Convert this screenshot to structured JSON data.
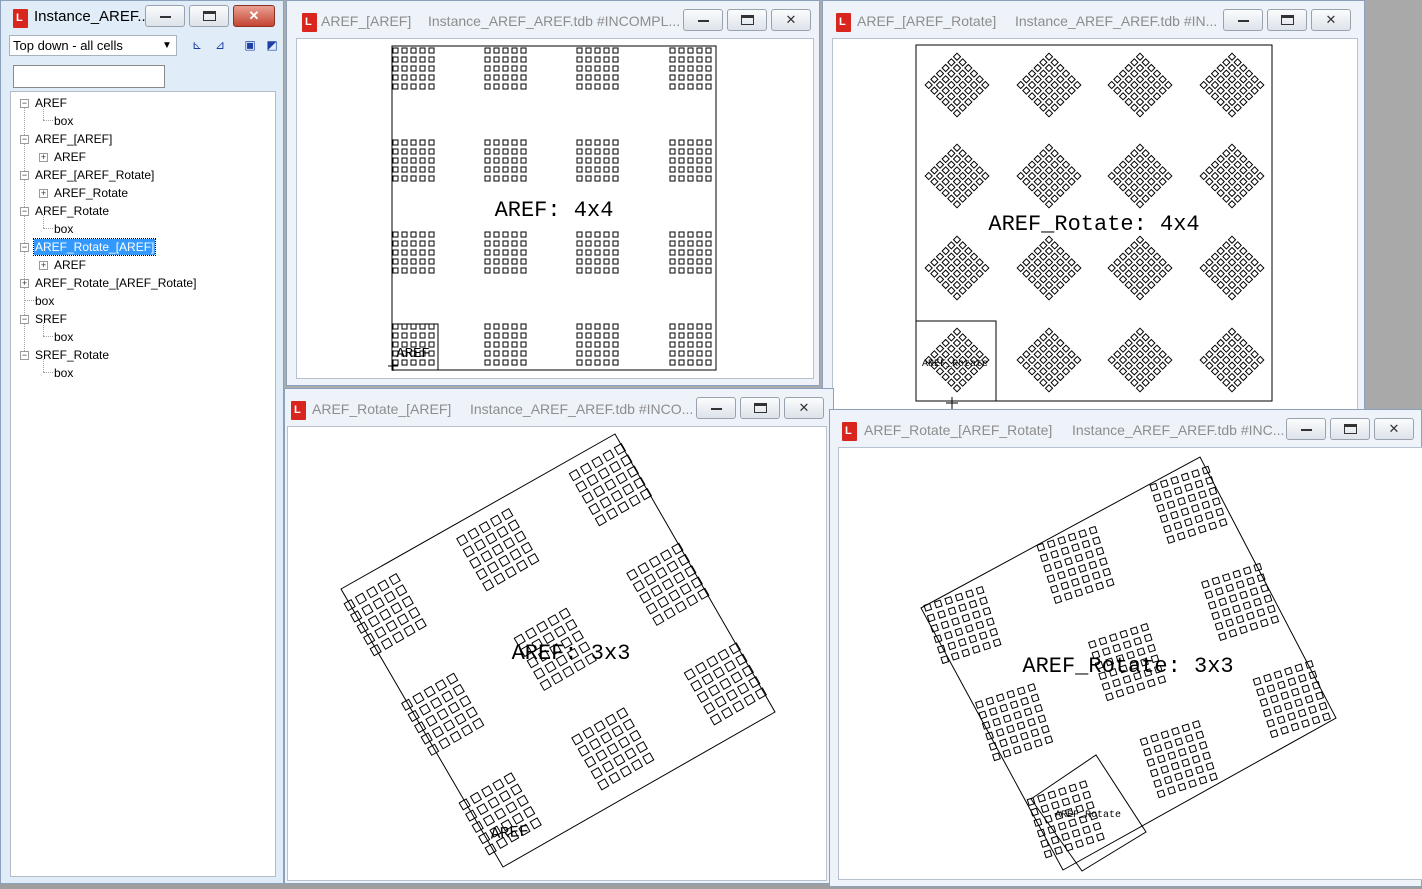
{
  "tree_window": {
    "title": "Instance_AREF...",
    "filter": "Top down - all cells",
    "search_value": "",
    "nodes": [
      "AREF",
      "box",
      "AREF_[AREF]",
      "AREF",
      "AREF_[AREF_Rotate]",
      "AREF_Rotate",
      "AREF_Rotate",
      "box",
      "AREF_Rotate_[AREF]",
      "AREF",
      "AREF_Rotate_[AREF_Rotate]",
      "box",
      "SREF",
      "box",
      "SREF_Rotate",
      "box"
    ]
  },
  "windows": [
    {
      "cell": "AREF_[AREF]",
      "file": "Instance_AREF_AREF.tdb #INCOMPL...",
      "label": "AREF: 4x4",
      "sub_label": "AREF"
    },
    {
      "cell": "AREF_[AREF_Rotate]",
      "file": "Instance_AREF_AREF.tdb #IN...",
      "label": "AREF_Rotate: 4x4",
      "sub_label": "AREF_Rotate"
    },
    {
      "cell": "AREF_Rotate_[AREF]",
      "file": "Instance_AREF_AREF.tdb #INCO...",
      "label": "AREF: 3x3",
      "sub_label": "AREF"
    },
    {
      "cell": "AREF_Rotate_[AREF_Rotate]",
      "file": "Instance_AREF_AREF.tdb #INC...",
      "label": "AREF_Rotate: 3x3",
      "sub_label": "AREF_Rotate"
    }
  ],
  "controls": {
    "minimize": "—",
    "maximize": "☐",
    "close": "✕"
  },
  "icons": [
    "app-icon",
    "minimize-icon",
    "maximize-icon",
    "close-icon",
    "chevron-down-icon",
    "expand-plus-icon",
    "collapse-minus-icon"
  ],
  "colors": {
    "selection": "#3399ff",
    "app_icon": "#d8261f",
    "close_active": "#c54433"
  }
}
